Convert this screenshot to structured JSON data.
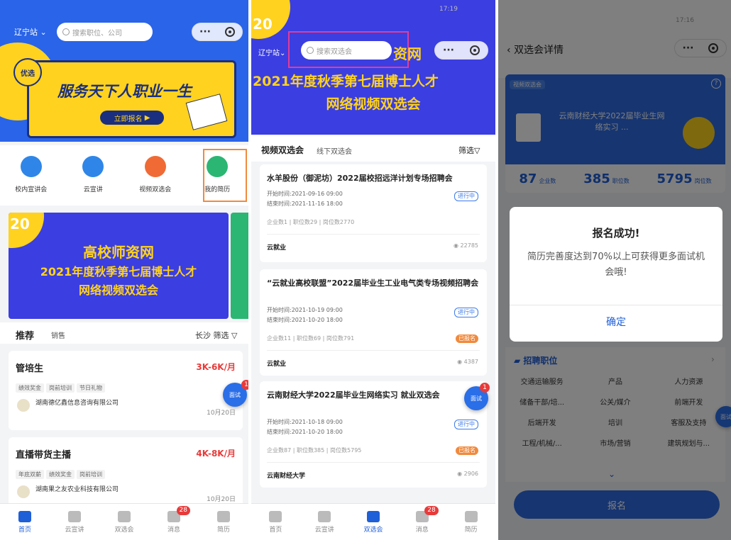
{
  "screen1": {
    "city": "辽宁站",
    "search_placeholder": "搜索职位、公司",
    "banner_tag": "优选",
    "banner_title": "服务天下人职业一生",
    "banner_button": "立即报名",
    "quick_nav": [
      {
        "label": "校内宣讲会",
        "color": "#2f86e8",
        "icon": "monitor-icon"
      },
      {
        "label": "云宣讲",
        "color": "#2f86e8",
        "icon": "cloud-icon"
      },
      {
        "label": "视频双选会",
        "color": "#f06a35",
        "icon": "people-icon"
      },
      {
        "label": "我的简历",
        "color": "#2bb673",
        "icon": "resume-icon"
      }
    ],
    "promo_year": "20",
    "promo_title": "高校师资网",
    "promo_line2": "2021年度秋季第七届博士人才",
    "promo_line3": "网络视频双选会",
    "section_tabs": [
      "推荐",
      "销售"
    ],
    "location_filter": "长沙 筛选",
    "jobs": [
      {
        "title": "管培生",
        "salary": "3K-6K/月",
        "tags": [
          "绩效奖金",
          "岗前培训",
          "节日礼物"
        ],
        "company": "湖南德亿鑫信息咨询有限公司",
        "date": "10月20日"
      },
      {
        "title": "直播带货主播",
        "salary": "4K-8K/月",
        "tags": [
          "年底双薪",
          "绩效奖金",
          "岗前培训"
        ],
        "company": "湖南果之友农业科技有限公司",
        "date": "10月20日"
      }
    ],
    "fab": "面试",
    "fab_badge": "1",
    "tabbar": [
      {
        "label": "首页",
        "active": true,
        "badge": ""
      },
      {
        "label": "云宣讲",
        "active": false,
        "badge": ""
      },
      {
        "label": "双选会",
        "active": false,
        "badge": ""
      },
      {
        "label": "消息",
        "active": false,
        "badge": "28"
      },
      {
        "label": "简历",
        "active": false,
        "badge": ""
      }
    ]
  },
  "screen2": {
    "status": "17:19",
    "city": "辽宁站",
    "search_placeholder": "搜索双选会",
    "banner_brand": "资网",
    "banner_year": "20",
    "banner_line1": "2021年度秋季第七届博士人才",
    "banner_line2": "网络视频双选会",
    "tab_active": "视频双选会",
    "tab_other": "线下双选会",
    "filter": "筛选",
    "fairs": [
      {
        "title": "水羊股份（御泥坊）2022届校招远洋计划专场招聘会",
        "start": "开始时间:2021-09-16 09:00",
        "end": "结束时间:2021-11-16 18:00",
        "stats": "企业数1 | 职位数29 | 岗位数2770",
        "status": "进行中",
        "extra": "",
        "org": "云就业",
        "views": "22785"
      },
      {
        "title": "“云就业高校联盟”2022届毕业生工业电气类专场视频招聘会",
        "start": "开始时间:2021-10-19 09:00",
        "end": "结束时间:2021-10-20 18:00",
        "stats": "企业数11 | 职位数69 | 岗位数791",
        "status": "进行中",
        "extra": "已报名",
        "org": "云就业",
        "views": "4387"
      },
      {
        "title": "云南财经大学2022届毕业生网络实习 就业双选会",
        "start": "开始时间:2021-10-18 09:00",
        "end": "结束时间:2021-10-20 18:00",
        "stats": "企业数87 | 职位数385 | 岗位数5795",
        "status": "进行中",
        "extra": "已报名",
        "org": "云南财经大学",
        "views": "2906"
      }
    ],
    "fab": "面试",
    "fab_badge": "1",
    "tabbar": [
      {
        "label": "首页",
        "active": false,
        "badge": ""
      },
      {
        "label": "云宣讲",
        "active": false,
        "badge": ""
      },
      {
        "label": "双选会",
        "active": true,
        "badge": ""
      },
      {
        "label": "消息",
        "active": false,
        "badge": "28"
      },
      {
        "label": "简历",
        "active": false,
        "badge": ""
      }
    ]
  },
  "screen3": {
    "status": "17:16",
    "nav_title": "双选会详情",
    "hero_tag": "视频双选会",
    "hero_title": "云南财经大学2022届毕业生网络实习 ...",
    "stats": [
      {
        "value": "87",
        "label": "企业数"
      },
      {
        "value": "385",
        "label": "职位数"
      },
      {
        "value": "5795",
        "label": "岗位数"
      }
    ],
    "dialog_title": "报名成功!",
    "dialog_body": "简历完善度达到70%以上可获得更多面试机会哦!",
    "dialog_button": "确定",
    "section_title": "招聘职位",
    "categories": [
      "交通运输服务",
      "产品",
      "人力资源",
      "储备干部/培...",
      "公关/媒介",
      "前端开发",
      "后端开发",
      "培训",
      "客服及支持",
      "工程/机械/...",
      "市场/营销",
      "建筑规划与..."
    ],
    "apply_button": "报名",
    "fab": "面试"
  }
}
